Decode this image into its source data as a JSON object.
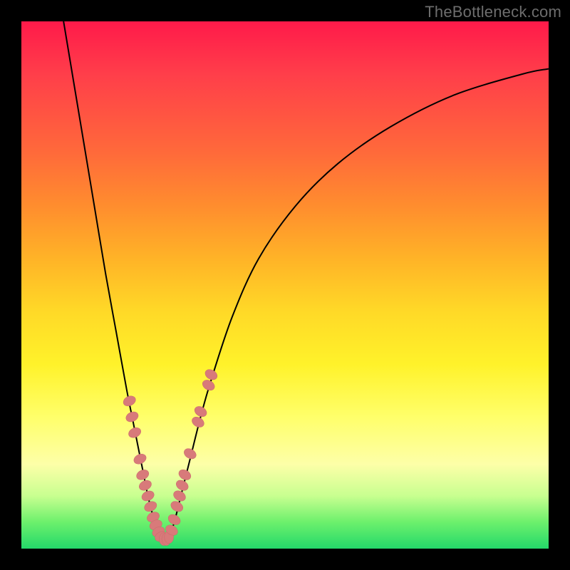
{
  "watermark": "TheBottleneck.com",
  "colors": {
    "curve_stroke": "#000000",
    "marker_fill": "#d87a7a",
    "marker_stroke": "#c96a6a",
    "frame_bg": "#000000"
  },
  "chart_data": {
    "type": "line",
    "title": "",
    "xlabel": "",
    "ylabel": "",
    "xlim": [
      0,
      100
    ],
    "ylim": [
      0,
      100
    ],
    "curves": [
      {
        "name": "left-branch",
        "x": [
          8,
          10,
          12,
          14,
          16,
          18,
          20,
          21,
          22,
          23,
          24,
          25,
          26
        ],
        "y": [
          100,
          88,
          76,
          64,
          52,
          41,
          30,
          25,
          20,
          15,
          10,
          6,
          2
        ]
      },
      {
        "name": "right-branch",
        "x": [
          28,
          29,
          30,
          31,
          32,
          34,
          36,
          40,
          45,
          52,
          60,
          70,
          82,
          95,
          100
        ],
        "y": [
          2,
          5,
          9,
          13,
          17,
          25,
          32,
          44,
          55,
          65,
          73,
          80,
          86,
          90,
          91
        ]
      },
      {
        "name": "valley-floor",
        "x": [
          26,
          27,
          28
        ],
        "y": [
          2,
          1.5,
          2
        ]
      }
    ],
    "markers": [
      {
        "x": 20.5,
        "y": 28
      },
      {
        "x": 21.0,
        "y": 25
      },
      {
        "x": 21.5,
        "y": 22
      },
      {
        "x": 22.5,
        "y": 17
      },
      {
        "x": 23.0,
        "y": 14
      },
      {
        "x": 23.5,
        "y": 12
      },
      {
        "x": 24.0,
        "y": 10
      },
      {
        "x": 24.5,
        "y": 8
      },
      {
        "x": 25.0,
        "y": 6
      },
      {
        "x": 25.5,
        "y": 4.5
      },
      {
        "x": 26.0,
        "y": 3.2
      },
      {
        "x": 26.5,
        "y": 2.3
      },
      {
        "x": 27.0,
        "y": 1.8
      },
      {
        "x": 27.5,
        "y": 1.8
      },
      {
        "x": 28.0,
        "y": 2.2
      },
      {
        "x": 28.5,
        "y": 3.5
      },
      {
        "x": 29.0,
        "y": 5.5
      },
      {
        "x": 29.5,
        "y": 8
      },
      {
        "x": 30.0,
        "y": 10
      },
      {
        "x": 30.5,
        "y": 12
      },
      {
        "x": 31.0,
        "y": 14
      },
      {
        "x": 32.0,
        "y": 18
      },
      {
        "x": 33.5,
        "y": 24
      },
      {
        "x": 34.0,
        "y": 26
      },
      {
        "x": 35.5,
        "y": 31
      },
      {
        "x": 36.0,
        "y": 33
      }
    ]
  }
}
